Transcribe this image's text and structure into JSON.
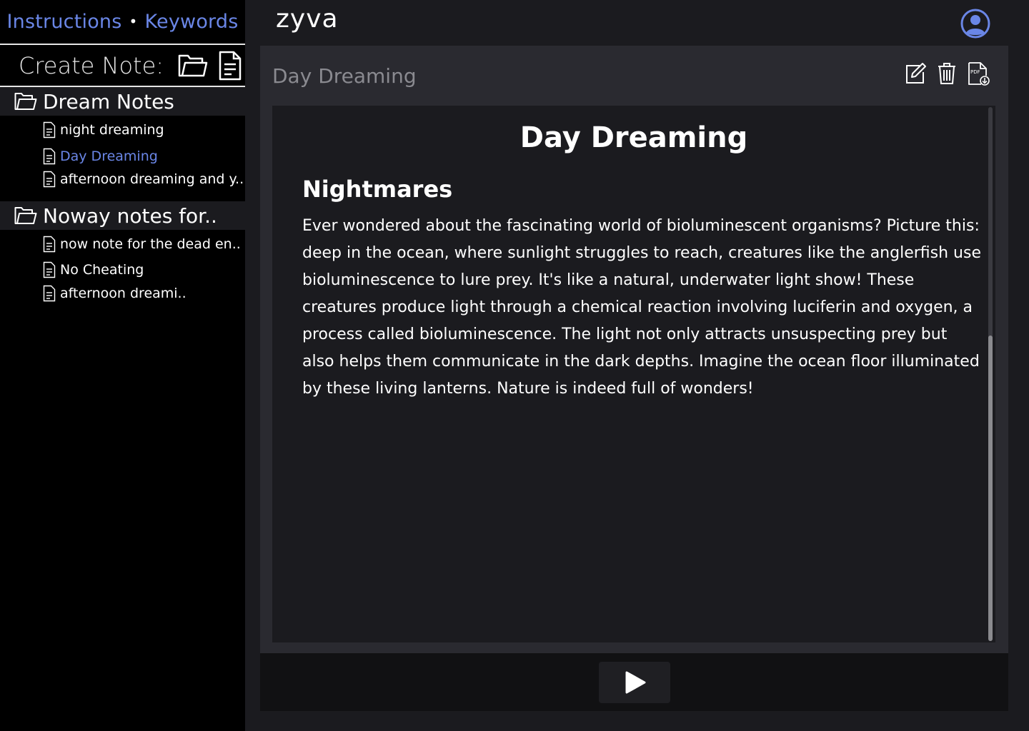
{
  "nav": {
    "instructions_label": "Instructions",
    "separator": "•",
    "keywords_label": "Keywords"
  },
  "create": {
    "label": "Create Note:",
    "new_folder_icon": "folder-open-icon",
    "new_note_icon": "file-text-icon"
  },
  "folders": [
    {
      "name": "Dream Notes",
      "notes": [
        {
          "title": "night dreaming",
          "active": false
        },
        {
          "title": "Day Dreaming",
          "active": true
        },
        {
          "title": "afternoon dreaming and y..",
          "active": false
        }
      ]
    },
    {
      "name": "Noway notes for..",
      "notes": [
        {
          "title": "now note for the dead en..",
          "active": false
        },
        {
          "title": "No Cheating",
          "active": false
        },
        {
          "title": "afternoon dreami..",
          "active": false
        }
      ]
    }
  ],
  "header": {
    "brand": "zyva",
    "avatar_icon": "user-circle-icon"
  },
  "note": {
    "bar_title": "Day Dreaming",
    "actions": [
      "edit-icon",
      "trash-icon",
      "pdf-download-icon"
    ],
    "title": "Day Dreaming",
    "heading": "Nightmares",
    "body": "Ever wondered about the fascinating world of bioluminescent organisms? Picture this: deep in the ocean, where sunlight struggles to reach, creatures like the anglerfish use bioluminescence to lure prey. It's like a natural, underwater light show! These creatures produce light through a chemical reaction involving luciferin and oxygen, a process called bioluminescence. The light not only attracts unsuspecting prey but also helps them communicate in the dark depths. Imagine the ocean floor illuminated by these living lanterns. Nature is indeed full of wonders!"
  },
  "player": {
    "play_icon": "play-icon"
  },
  "colors": {
    "accent": "#6a86e6",
    "sidebar_bg": "#000000",
    "panel_bg": "#2a2a30",
    "editor_bg": "#1b1b1f"
  }
}
